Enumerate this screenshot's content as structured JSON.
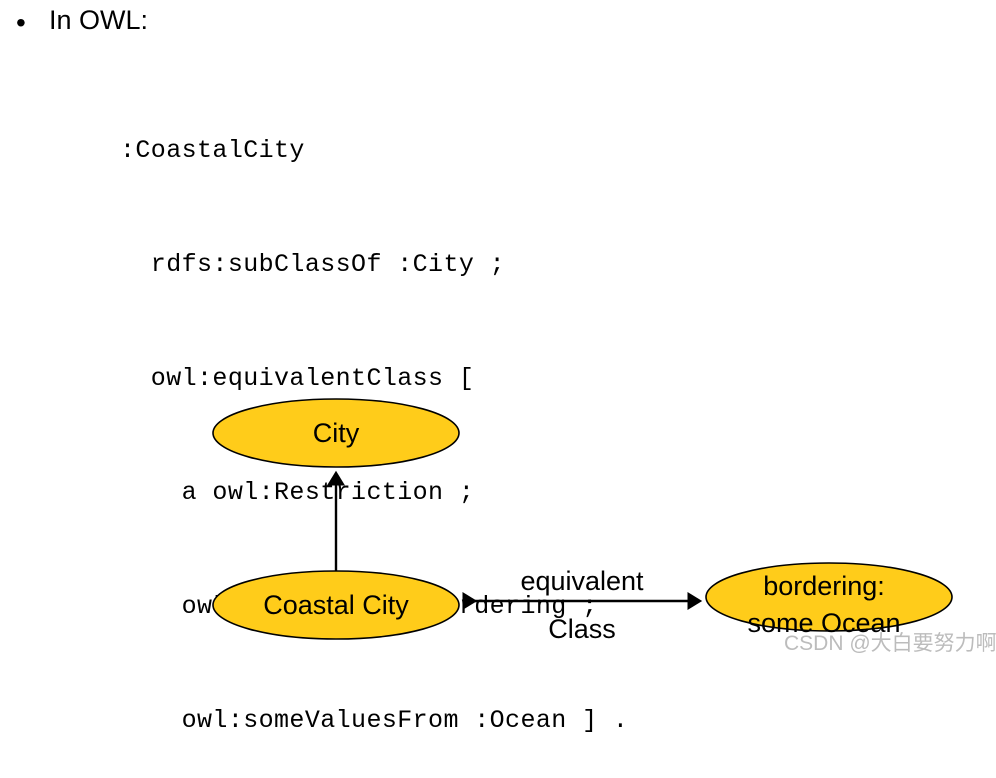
{
  "slide": {
    "bullet_marker": "•",
    "bullet_text": "In OWL:",
    "background_color": "#ffffff"
  },
  "code": {
    "language": "turtle",
    "lines": [
      ":CoastalCity",
      "  rdfs:subClassOf :City ;",
      "  owl:equivalentClass [",
      "    a owl:Restriction ;",
      "    owl:onProperty :bordering ;",
      "    owl:someValuesFrom :Ocean ] ."
    ]
  },
  "diagram": {
    "node_fill_color": "#FFCC1A",
    "node_stroke_color": "#000000",
    "nodes": [
      {
        "id": "city",
        "label": "City",
        "lines": [
          "City"
        ]
      },
      {
        "id": "coastal-city",
        "label": "Coastal City",
        "lines": [
          "Coastal City"
        ]
      },
      {
        "id": "bordering-some-ocean",
        "label": "bordering: some Ocean",
        "lines": [
          "bordering:",
          "some Ocean"
        ]
      }
    ],
    "edges": [
      {
        "id": "subclass-edge",
        "from": "coastal-city",
        "to": "city",
        "label": "",
        "arrow": "single",
        "direction": "up"
      },
      {
        "id": "equivalent-class-edge",
        "from": "coastal-city",
        "to": "bordering-some-ocean",
        "label": "equivalentClass",
        "label_lines": [
          "equivalent",
          "Class"
        ],
        "arrow": "double",
        "direction": "horizontal"
      }
    ]
  },
  "watermark": {
    "text": "CSDN @大白要努力啊",
    "color": "#b9b9b9"
  }
}
